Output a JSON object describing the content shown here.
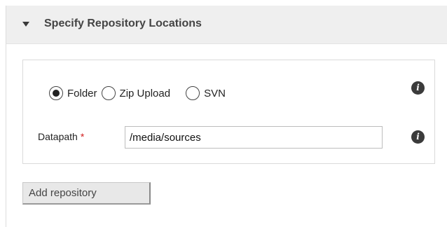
{
  "panel": {
    "title": "Specify Repository Locations",
    "expanded": true
  },
  "source_type": {
    "options": [
      {
        "label": "Folder",
        "selected": true
      },
      {
        "label": "Zip Upload",
        "selected": false
      },
      {
        "label": "SVN",
        "selected": false
      }
    ],
    "info_icon": "info-icon"
  },
  "datapath": {
    "label": "Datapath",
    "required_marker": "*",
    "value": "/media/sources",
    "info_icon": "info-icon"
  },
  "actions": {
    "add_repository_label": "Add repository"
  },
  "colors": {
    "header_bg": "#efefef",
    "required": "#d11d1d",
    "info_icon_bg": "#3b3b3b"
  }
}
